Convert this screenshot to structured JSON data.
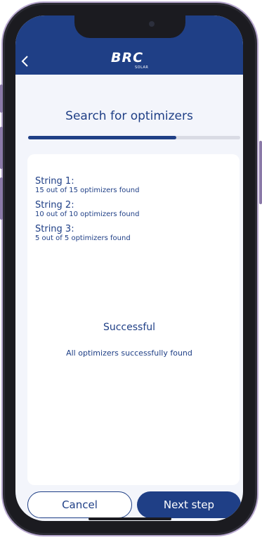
{
  "header": {
    "logo_text": "BRC",
    "logo_subtext": "SOLAR"
  },
  "page": {
    "title": "Search for optimizers",
    "progress": 0.7
  },
  "strings": [
    {
      "title": "String 1:",
      "detail": "15 out of 15 optimizers found"
    },
    {
      "title": "String 2:",
      "detail": "10 out of 10 optimizers found"
    },
    {
      "title": "String 3:",
      "detail": "5 out of 5 optimizers found"
    }
  ],
  "status": {
    "title": "Successful",
    "message": "All optimizers successfully found"
  },
  "buttons": {
    "cancel": "Cancel",
    "next": "Next step"
  },
  "colors": {
    "brand": "#1f3f86",
    "screen_bg": "#f3f5fb"
  }
}
